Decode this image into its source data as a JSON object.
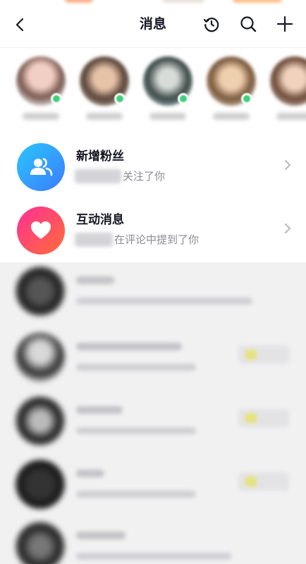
{
  "header": {
    "title": "消息",
    "back_icon": "chevron-left-icon",
    "history_icon": "history-icon",
    "search_icon": "search-icon",
    "add_icon": "plus-icon"
  },
  "friends": {
    "count": 5,
    "online_color": "#3ed07a"
  },
  "notices": [
    {
      "title": "新增粉丝",
      "subtitle": "关注了你",
      "icon": "users-icon",
      "gradient": [
        "#2bb8ff",
        "#3d7dff"
      ]
    },
    {
      "title": "互动消息",
      "subtitle": "在评论中提到了你",
      "icon": "heart-icon",
      "gradient": [
        "#ff3d8b",
        "#ff6a3d"
      ]
    }
  ],
  "colors": {
    "text_primary": "#161823",
    "text_secondary": "#8a8b91",
    "blur_bg": "#f1f1f2"
  }
}
